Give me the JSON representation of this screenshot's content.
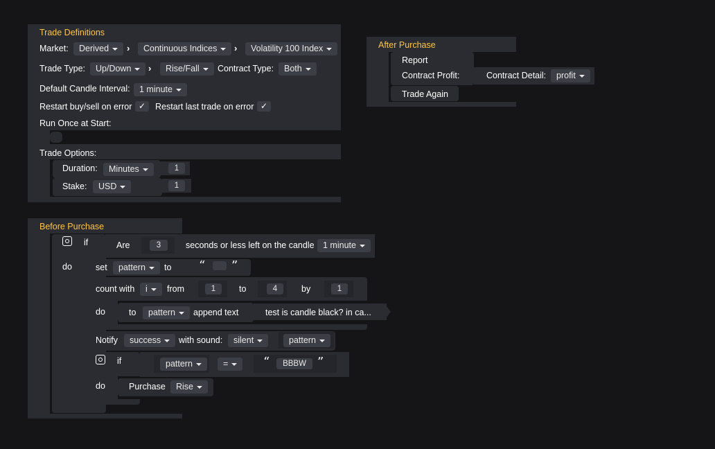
{
  "trade_definitions": {
    "title": "Trade Definitions",
    "market_label": "Market:",
    "market": "Derived",
    "submarket": "Continuous Indices",
    "symbol": "Volatility 100 Index",
    "trade_type_label": "Trade Type:",
    "trade_category": "Up/Down",
    "trade_type": "Rise/Fall",
    "contract_type_label": "Contract Type:",
    "contract_type": "Both",
    "candle_interval_label": "Default Candle Interval:",
    "candle_interval": "1 minute",
    "restart_on_error_label": "Restart buy/sell on error",
    "restart_last_trade_label": "Restart last trade on error",
    "check_mark": "✓",
    "run_once_label": "Run Once at Start:",
    "trade_options_label": "Trade Options:",
    "duration_label": "Duration:",
    "duration_unit": "Minutes",
    "duration_value": "1",
    "stake_label": "Stake:",
    "currency": "USD",
    "stake_value": "1"
  },
  "after_purchase": {
    "title": "After Purchase",
    "report_label": "Report",
    "contract_profit_label": "Contract Profit:",
    "contract_detail_label": "Contract Detail:",
    "contract_detail": "profit",
    "trade_again_label": "Trade Again"
  },
  "before_purchase": {
    "title": "Before Purchase",
    "if_label": "if",
    "do_label": "do",
    "are_label": "Are",
    "seconds_value": "3",
    "seconds_text": "seconds or less left on the candle",
    "candle_interval": "1 minute",
    "set_label": "set",
    "variable": "pattern",
    "to_label": "to",
    "open_quote": "“",
    "close_quote": "”",
    "count_with_label": "count with",
    "count_var": "i",
    "from_label": "from",
    "from_value": "1",
    "count_to_label": "to",
    "to_value": "4",
    "by_label": "by",
    "by_value": "1",
    "inner_do_label": "do",
    "append_to_label": "to",
    "append_var": "pattern",
    "append_text_label": "append text",
    "append_value": "test is candle black? in ca...",
    "notify_label": "Notify",
    "notify_type": "success",
    "with_sound_label": "with sound:",
    "sound": "silent",
    "notify_var": "pattern",
    "if2_label": "if",
    "compare_var": "pattern",
    "operator": "=",
    "compare_value": "BBBW",
    "do2_label": "do",
    "purchase_label": "Purchase",
    "purchase_type": "Rise"
  },
  "colors": {
    "background": "#151517",
    "block": "#2a2c31",
    "title": "#ffc53d",
    "field": "#3b3e45"
  }
}
